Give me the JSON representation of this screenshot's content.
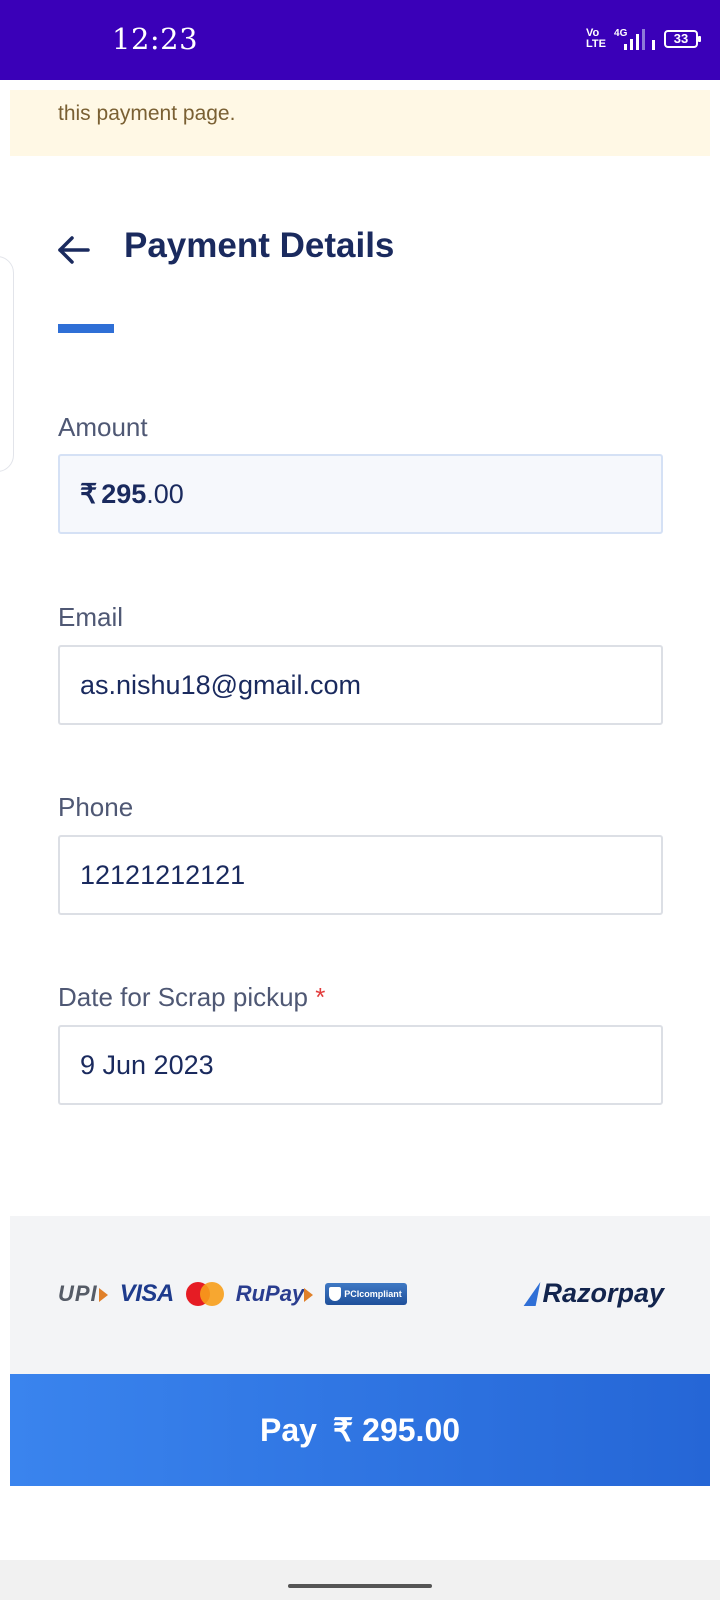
{
  "status_bar": {
    "time": "12:23",
    "network_top": "Vo",
    "network_bottom": "LTE",
    "network_type": "4G",
    "battery": "33"
  },
  "notice": {
    "text": "this payment page."
  },
  "header": {
    "title": "Payment Details"
  },
  "form": {
    "amount": {
      "label": "Amount",
      "currency": "₹",
      "whole": "295",
      "fraction": ".00"
    },
    "email": {
      "label": "Email",
      "value": "as.nishu18@gmail.com"
    },
    "phone": {
      "label": "Phone",
      "value": "12121212121"
    },
    "pickup_date": {
      "label": "Date for Scrap pickup",
      "required_mark": "*",
      "value": "9 Jun 2023"
    }
  },
  "footer": {
    "logos": {
      "upi": "UPI",
      "visa": "VISA",
      "rupay": "RuPay",
      "pci": "PCIcompliant",
      "razorpay": "Razorpay"
    },
    "pay_button": {
      "label": "Pay",
      "amount": "₹ 295.00"
    }
  },
  "colors": {
    "status_bar": "#3a00b8",
    "title": "#1a2a5e",
    "accent": "#2f6fd6",
    "pay_button": "#2f72e2",
    "notice_bg": "#fff8e5"
  }
}
